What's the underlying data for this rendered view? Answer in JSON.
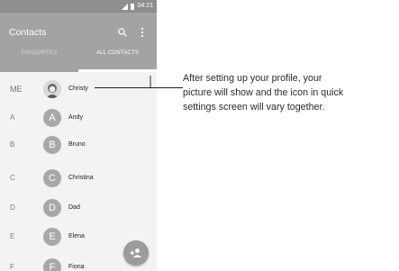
{
  "status_bar": {
    "time": "04:21"
  },
  "app_bar": {
    "title": "Contacts"
  },
  "tabs": [
    {
      "label": "FAVOURITES",
      "active": false
    },
    {
      "label": "ALL CONTACTS",
      "active": true
    }
  ],
  "contacts": [
    {
      "section": "ME",
      "initial": "",
      "name": "Christy",
      "has_photo": true
    },
    {
      "section": "A",
      "initial": "A",
      "name": "Andy",
      "has_photo": false
    },
    {
      "section": "B",
      "initial": "B",
      "name": "Bruno",
      "has_photo": false
    },
    {
      "section": "C",
      "initial": "C",
      "name": "Christina",
      "has_photo": false
    },
    {
      "section": "D",
      "initial": "D",
      "name": "Dad",
      "has_photo": false
    },
    {
      "section": "E",
      "initial": "E",
      "name": "Elena",
      "has_photo": false
    },
    {
      "section": "F",
      "initial": "F",
      "name": "Fiona",
      "has_photo": false
    }
  ],
  "fab": {
    "icon": "add-contact-icon"
  },
  "callout": {
    "text": "After setting up your profile, your\npicture will show and the icon in quick\nsettings screen will vary together."
  }
}
